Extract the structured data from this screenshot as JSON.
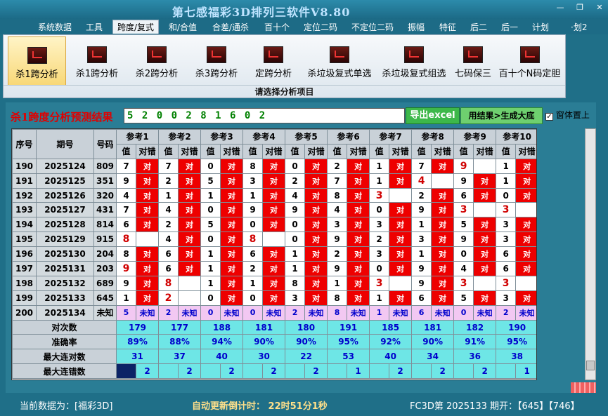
{
  "app_title": "第七感福彩3D排列三软件V8.80",
  "window_controls": [
    "—",
    "❐",
    "✕"
  ],
  "menu": [
    "系统数据",
    "工具",
    "跨度/复式",
    "和/合值",
    "合差/通杀",
    "百十个",
    "定位二码",
    "不定位二码",
    "振幅",
    "特征",
    "后二",
    "后一",
    "计划",
    "·划2"
  ],
  "ribbon": {
    "buttons": [
      "杀1跨分析",
      "杀1跨分析",
      "杀2跨分析",
      "杀3跨分析",
      "定跨分析",
      "杀垃圾复式单选",
      "杀垃圾复式组选",
      "七码保三",
      "百十个N码定胆"
    ],
    "caption": "请选择分析项目"
  },
  "result": {
    "label": "杀1跨度分析预测结果",
    "value": "5 2 0 0 2 8 1 6 0 2",
    "export_label": "导出excel",
    "generate_label": "用结果>生成大底",
    "topmost_label": "窗体置上",
    "topmost_check": "✓"
  },
  "table": {
    "headers": {
      "seq": "序号",
      "issue": "期号",
      "code": "号码",
      "value": "值",
      "match": "对错"
    },
    "refs": [
      "参考1",
      "参考2",
      "参考3",
      "参考4",
      "参考5",
      "参考6",
      "参考7",
      "参考8",
      "参考9",
      "参考10"
    ],
    "rows": [
      {
        "seq": "190",
        "issue": "2025124",
        "code": "809",
        "cells": [
          [
            "7",
            "对"
          ],
          [
            "7",
            "对"
          ],
          [
            "0",
            "对"
          ],
          [
            "8",
            "对"
          ],
          [
            "0",
            "对"
          ],
          [
            "2",
            "对"
          ],
          [
            "1",
            "对"
          ],
          [
            "7",
            "对"
          ],
          [
            "9",
            ""
          ],
          [
            "1",
            "对"
          ]
        ]
      },
      {
        "seq": "191",
        "issue": "2025125",
        "code": "351",
        "cells": [
          [
            "9",
            "对"
          ],
          [
            "2",
            "对"
          ],
          [
            "5",
            "对"
          ],
          [
            "3",
            "对"
          ],
          [
            "2",
            "对"
          ],
          [
            "7",
            "对"
          ],
          [
            "1",
            "对"
          ],
          [
            "4",
            ""
          ],
          [
            "9",
            "对"
          ],
          [
            "1",
            "对"
          ]
        ]
      },
      {
        "seq": "192",
        "issue": "2025126",
        "code": "320",
        "cells": [
          [
            "4",
            "对"
          ],
          [
            "1",
            "对"
          ],
          [
            "1",
            "对"
          ],
          [
            "1",
            "对"
          ],
          [
            "4",
            "对"
          ],
          [
            "8",
            "对"
          ],
          [
            "3",
            ""
          ],
          [
            "2",
            "对"
          ],
          [
            "6",
            "对"
          ],
          [
            "0",
            "对"
          ]
        ]
      },
      {
        "seq": "193",
        "issue": "2025127",
        "code": "431",
        "cells": [
          [
            "7",
            "对"
          ],
          [
            "4",
            "对"
          ],
          [
            "0",
            "对"
          ],
          [
            "9",
            "对"
          ],
          [
            "9",
            "对"
          ],
          [
            "4",
            "对"
          ],
          [
            "0",
            "对"
          ],
          [
            "9",
            "对"
          ],
          [
            "3",
            ""
          ],
          [
            "3",
            ""
          ]
        ]
      },
      {
        "seq": "194",
        "issue": "2025128",
        "code": "814",
        "cells": [
          [
            "6",
            "对"
          ],
          [
            "2",
            "对"
          ],
          [
            "5",
            "对"
          ],
          [
            "0",
            "对"
          ],
          [
            "0",
            "对"
          ],
          [
            "3",
            "对"
          ],
          [
            "3",
            "对"
          ],
          [
            "1",
            "对"
          ],
          [
            "5",
            "对"
          ],
          [
            "3",
            "对"
          ]
        ]
      },
      {
        "seq": "195",
        "issue": "2025129",
        "code": "915",
        "cells": [
          [
            "8",
            ""
          ],
          [
            "4",
            "对"
          ],
          [
            "0",
            "对"
          ],
          [
            "8",
            ""
          ],
          [
            "0",
            "对"
          ],
          [
            "9",
            "对"
          ],
          [
            "2",
            "对"
          ],
          [
            "3",
            "对"
          ],
          [
            "9",
            "对"
          ],
          [
            "3",
            "对"
          ]
        ]
      },
      {
        "seq": "196",
        "issue": "2025130",
        "code": "204",
        "cells": [
          [
            "8",
            "对"
          ],
          [
            "6",
            "对"
          ],
          [
            "1",
            "对"
          ],
          [
            "6",
            "对"
          ],
          [
            "1",
            "对"
          ],
          [
            "2",
            "对"
          ],
          [
            "3",
            "对"
          ],
          [
            "1",
            "对"
          ],
          [
            "0",
            "对"
          ],
          [
            "6",
            "对"
          ]
        ]
      },
      {
        "seq": "197",
        "issue": "2025131",
        "code": "203",
        "cells": [
          [
            "9",
            "对"
          ],
          [
            "6",
            "对"
          ],
          [
            "1",
            "对"
          ],
          [
            "2",
            "对"
          ],
          [
            "1",
            "对"
          ],
          [
            "9",
            "对"
          ],
          [
            "0",
            "对"
          ],
          [
            "9",
            "对"
          ],
          [
            "4",
            "对"
          ],
          [
            "6",
            "对"
          ]
        ]
      },
      {
        "seq": "198",
        "issue": "2025132",
        "code": "689",
        "cells": [
          [
            "9",
            "对"
          ],
          [
            "8",
            ""
          ],
          [
            "1",
            "对"
          ],
          [
            "1",
            "对"
          ],
          [
            "8",
            "对"
          ],
          [
            "1",
            "对"
          ],
          [
            "3",
            ""
          ],
          [
            "9",
            "对"
          ],
          [
            "3",
            ""
          ],
          [
            "3",
            ""
          ]
        ]
      },
      {
        "seq": "199",
        "issue": "2025133",
        "code": "645",
        "cells": [
          [
            "1",
            "对"
          ],
          [
            "2",
            ""
          ],
          [
            "0",
            "对"
          ],
          [
            "0",
            "对"
          ],
          [
            "3",
            "对"
          ],
          [
            "8",
            "对"
          ],
          [
            "1",
            "对"
          ],
          [
            "6",
            "对"
          ],
          [
            "5",
            "对"
          ],
          [
            "3",
            "对"
          ]
        ]
      }
    ],
    "hot_cells": [
      [
        0,
        8
      ],
      [
        1,
        7
      ],
      [
        2,
        6
      ],
      [
        3,
        8
      ],
      [
        3,
        9
      ],
      [
        5,
        0
      ],
      [
        5,
        3
      ],
      [
        7,
        0
      ],
      [
        8,
        1
      ],
      [
        8,
        6
      ],
      [
        8,
        8
      ],
      [
        8,
        9
      ],
      [
        9,
        1
      ]
    ],
    "pred_row": {
      "seq": "200",
      "issue": "2025134",
      "code": "未知",
      "cells": [
        [
          "5",
          "未知"
        ],
        [
          "2",
          "未知"
        ],
        [
          "0",
          "未知"
        ],
        [
          "0",
          "未知"
        ],
        [
          "2",
          "未知"
        ],
        [
          "8",
          "未知"
        ],
        [
          "1",
          "未知"
        ],
        [
          "6",
          "未知"
        ],
        [
          "0",
          "未知"
        ],
        [
          "2",
          "未知"
        ]
      ]
    },
    "stats": [
      {
        "label": "对次数",
        "values": [
          "179",
          "177",
          "188",
          "181",
          "180",
          "191",
          "185",
          "181",
          "182",
          "190"
        ]
      },
      {
        "label": "准确率",
        "values": [
          "89%",
          "88%",
          "94%",
          "90%",
          "90%",
          "95%",
          "92%",
          "90%",
          "91%",
          "95%"
        ]
      },
      {
        "label": "最大连对数",
        "values": [
          "31",
          "37",
          "40",
          "30",
          "22",
          "53",
          "40",
          "34",
          "36",
          "38"
        ]
      },
      {
        "label": "最大连错数",
        "values": [
          "2",
          "2",
          "2",
          "2",
          "2",
          "1",
          "2",
          "2",
          "2",
          "1"
        ]
      }
    ]
  },
  "status": {
    "current_data": "当前数据为：[福彩3D]",
    "countdown": "自动更新倒计时： 22时51分1秒",
    "latest": "FC3D第 2025133 期开：【645】【746】"
  },
  "colors": {
    "hit": "#ee0000",
    "prediction_row": "#f2c8f2",
    "stats": "#6ee6e6",
    "result_text": "#008000"
  }
}
